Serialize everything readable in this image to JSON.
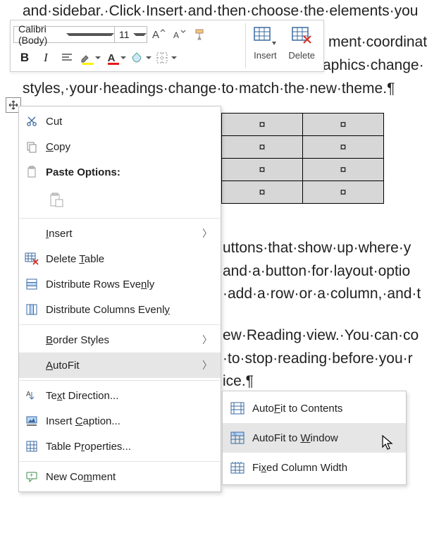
{
  "document": {
    "line1": "and·sidebar.·Click·Insert·and·then·choose·the·elements·you",
    "line2a": "ment·coordinat",
    "line2b": "aphics·change·",
    "line2c": "styles,·your·headings·change·to·match·the·new·theme.¶",
    "block2": [
      "uttons·that·show·up·where·y",
      "and·a·button·for·layout·optio",
      "·add·a·row·or·a·column,·and·t"
    ],
    "block3": [
      "ew·Reading·view.·You·can·co",
      "·to·stop·reading·before·you·r",
      "ice.¶"
    ],
    "table_cell_marker": "¤"
  },
  "mini_toolbar": {
    "font_name": "Calibri (Body)",
    "font_size": "11",
    "insert_label": "Insert",
    "delete_label": "Delete"
  },
  "context_menu": {
    "cut": "Cut",
    "copy": "Copy",
    "paste_options": "Paste Options:",
    "insert": "Insert",
    "delete_table": "Delete Table",
    "distribute_rows": "Distribute Rows Evenly",
    "distribute_cols": "Distribute Columns Evenly",
    "border_styles": "Border Styles",
    "autofit": "AutoFit",
    "text_direction": "Text Direction...",
    "insert_caption": "Insert Caption...",
    "table_properties": "Table Properties...",
    "new_comment": "New Comment"
  },
  "autofit_submenu": {
    "to_contents": "AutoFit to Contents",
    "to_window": "AutoFit to Window",
    "fixed": "Fixed Column Width"
  }
}
